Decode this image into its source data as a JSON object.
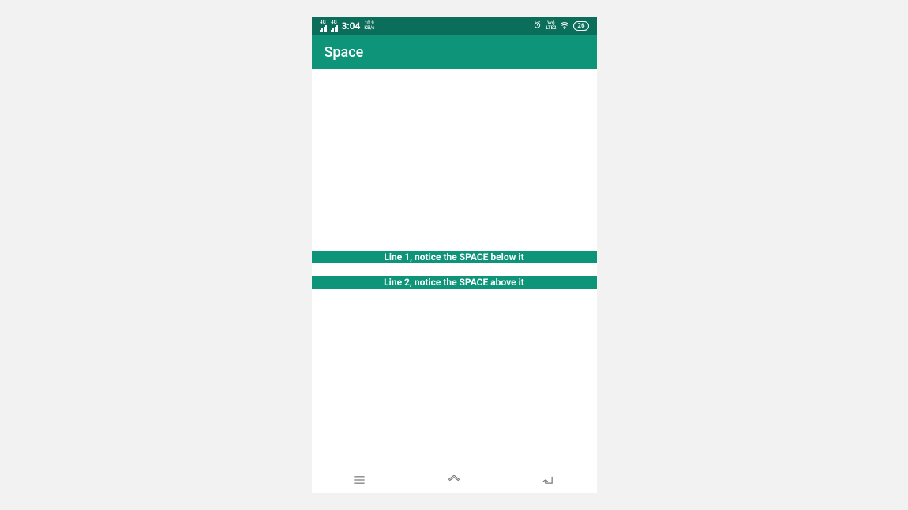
{
  "status": {
    "signal1_label": "4G",
    "signal2_label": "4G",
    "time": "3:04",
    "rate_value": "10.9",
    "rate_unit": "KB/s",
    "lte_top": "Vo)",
    "lte_bottom": "LTE2",
    "battery": "26"
  },
  "appbar": {
    "title": "Space"
  },
  "lines": {
    "line1": "Line 1, notice the SPACE below it",
    "line2": "Line 2, notice the SPACE above it"
  }
}
